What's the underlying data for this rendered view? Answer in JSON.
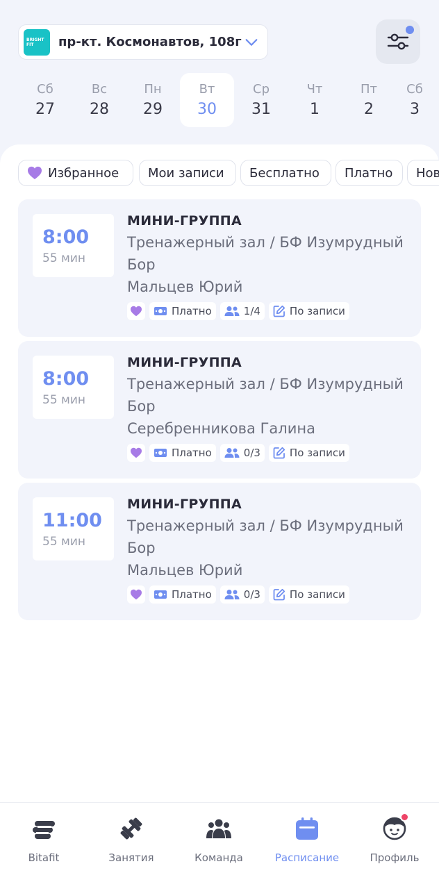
{
  "header": {
    "club_logo_line1": "BRIGHT",
    "club_logo_line2": "FIT",
    "club_address": "пр-кт. Космонавтов, 108г",
    "filter_has_updates": true
  },
  "days": [
    {
      "name": "Сб",
      "num": "27",
      "active": false
    },
    {
      "name": "Вс",
      "num": "28",
      "active": false
    },
    {
      "name": "Пн",
      "num": "29",
      "active": false
    },
    {
      "name": "Вт",
      "num": "30",
      "active": true
    },
    {
      "name": "Ср",
      "num": "31",
      "active": false
    },
    {
      "name": "Чт",
      "num": "1",
      "active": false
    },
    {
      "name": "Пт",
      "num": "2",
      "active": false
    },
    {
      "name": "Сб",
      "num": "3",
      "active": false
    }
  ],
  "filters": {
    "favorites": "Избранное",
    "my_bookings": "Мои записи",
    "free": "Бесплатно",
    "paid": "Платно",
    "new": "Нов"
  },
  "classes": [
    {
      "time": "8:00",
      "duration": "55 мин",
      "type": "МИНИ-ГРУППА",
      "place_line1": "Тренажерный зал / БФ Изумрудный",
      "place_line2": "Бор",
      "trainer": "Мальцев Юрий",
      "price": "Платно",
      "capacity": "1/4",
      "booking": "По записи"
    },
    {
      "time": "8:00",
      "duration": "55 мин",
      "type": "МИНИ-ГРУППА",
      "place_line1": "Тренажерный зал / БФ Изумрудный",
      "place_line2": "Бор",
      "trainer": "Серебренникова Галина",
      "price": "Платно",
      "capacity": "0/3",
      "booking": "По записи"
    },
    {
      "time": "11:00",
      "duration": "55 мин",
      "type": "МИНИ-ГРУППА",
      "place_line1": "Тренажерный зал / БФ Изумрудный",
      "place_line2": "Бор",
      "trainer": "Мальцев Юрий",
      "price": "Платно",
      "capacity": "0/3",
      "booking": "По записи"
    }
  ],
  "nav": {
    "home": "Bitafit",
    "classes": "Занятия",
    "team": "Команда",
    "schedule": "Расписание",
    "profile": "Профиль",
    "active": "schedule"
  },
  "colors": {
    "accent": "#6f8ef0",
    "heart": "#a77be6",
    "badge": "#ee4467",
    "brand_logo": "#19c2c6"
  }
}
